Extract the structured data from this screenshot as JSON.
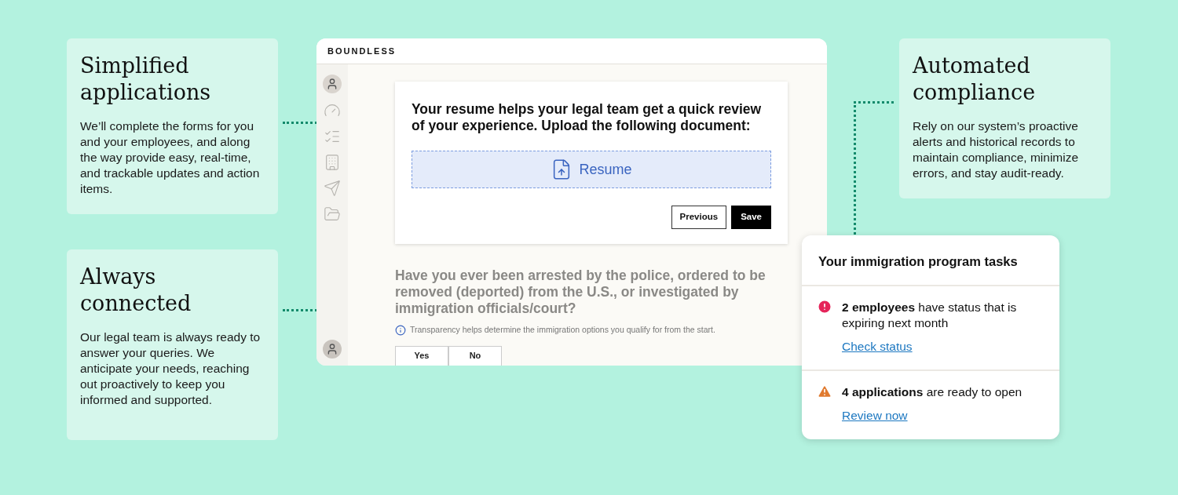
{
  "features": [
    {
      "title": "Simplified applications",
      "body": "We’ll complete the forms for you and your employees, and along the way provide easy, real-time, and trackable updates and action items."
    },
    {
      "title": "Always connected",
      "body": "Our legal team is always ready to answer your queries. We anticipate your needs, reaching out proactively to keep you informed and supported."
    },
    {
      "title": "Automated compliance",
      "body": "Rely on our system’s proactive alerts and historical records to maintain compliance, minimize errors, and stay audit-ready."
    }
  ],
  "app": {
    "logo": "BOUNDLESS",
    "upload_card": {
      "prompt": "Your resume helps your legal team get a quick review of your experience. Upload the following document:",
      "dropzone": "Resume",
      "buttons": [
        {
          "label": "Previous",
          "kind": "secondary"
        },
        {
          "label": "Save",
          "kind": "primary"
        }
      ]
    },
    "question": {
      "text": "Have you ever been arrested by the police, ordered to be removed (deported) from the U.S., or investigated by immigration officials/court?",
      "hint": "Transparency helps determine the immigration options you qualify for from the start.",
      "options": [
        {
          "label": "Yes",
          "selected": false
        },
        {
          "label": "No",
          "selected": false
        }
      ]
    }
  },
  "tasks": {
    "title": "Your immigration program tasks",
    "items": [
      {
        "kind": "error",
        "text": "**2 employees** have status that is expiring next month",
        "link": "Check status"
      },
      {
        "kind": "warning",
        "text": "**4 applications** are ready to open",
        "link": "Review now"
      }
    ]
  }
}
